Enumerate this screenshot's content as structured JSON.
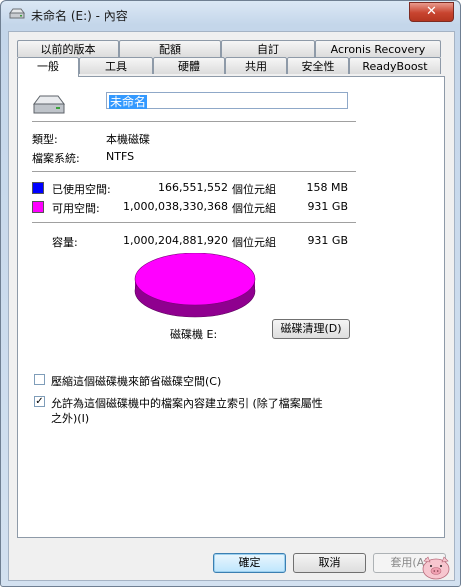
{
  "window": {
    "title": "未命名 (E:) - 內容",
    "close_label": "✕"
  },
  "tabs_row1": [
    "以前的版本",
    "配額",
    "自訂",
    "Acronis Recovery"
  ],
  "tabs_row2": [
    "一般",
    "工具",
    "硬體",
    "共用",
    "安全性",
    "ReadyBoost"
  ],
  "general": {
    "volume_name": "未命名",
    "type_label": "類型:",
    "type_value": "本機磁碟",
    "fs_label": "檔案系統:",
    "fs_value": "NTFS",
    "used": {
      "label": "已使用空間:",
      "bytes": "166,551,552",
      "unit": "個位元組",
      "size": "158 MB",
      "color": "#0000ff"
    },
    "free": {
      "label": "可用空間:",
      "bytes": "1,000,038,330,368",
      "unit": "個位元組",
      "size": "931 GB",
      "color": "#ff00ff"
    },
    "capacity": {
      "label": "容量:",
      "bytes": "1,000,204,881,920",
      "unit": "個位元組",
      "size": "931 GB"
    },
    "drive_label": "磁碟機 E:",
    "cleanup_button": "磁碟清理(D)",
    "compress_label": "壓縮這個磁碟機來節省磁碟空間(C)",
    "compress_checked": false,
    "index_label_line1": "允許為這個磁碟機中的檔案內容建立索引 (除了檔案屬性",
    "index_label_line2": "之外)(I)",
    "index_checked": true,
    "used_fraction": 0.0002
  },
  "buttons": {
    "ok": "確定",
    "cancel": "取消",
    "apply": "套用(A)"
  }
}
